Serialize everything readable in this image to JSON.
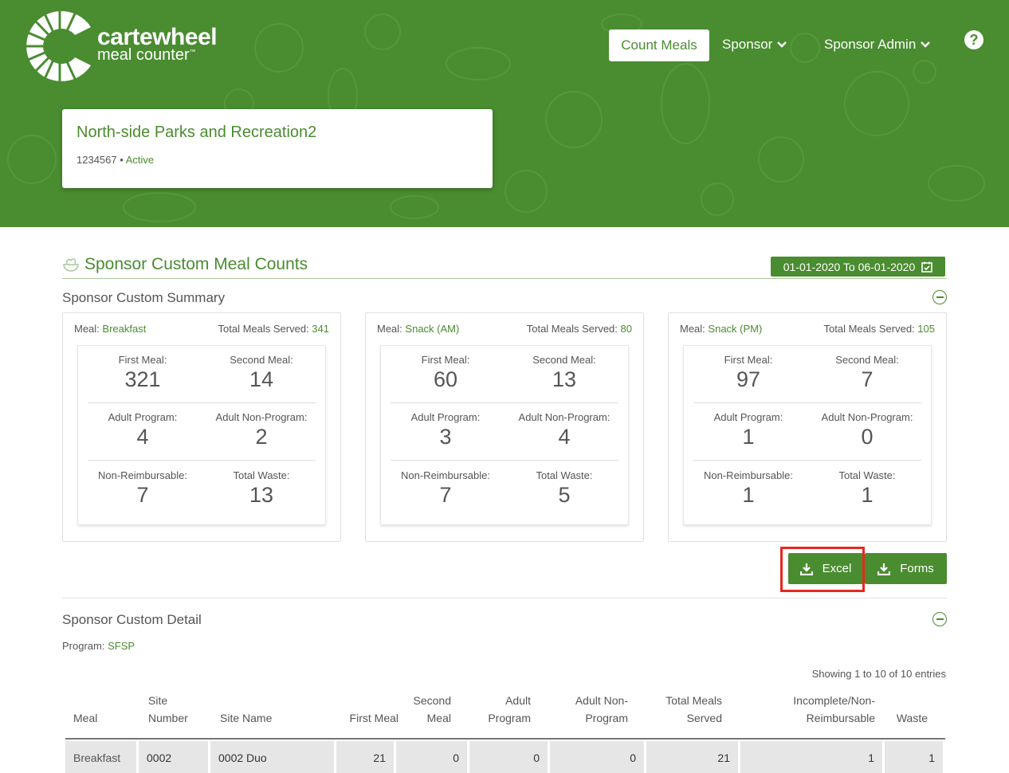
{
  "brand": {
    "name_line1": "cartewheel",
    "name_line2": "meal counter",
    "trademark": "™"
  },
  "nav": {
    "count_meals": "Count Meals",
    "sponsor": "Sponsor",
    "sponsor_admin": "Sponsor Admin",
    "help_icon": "question-circle-icon"
  },
  "org": {
    "name": "North-side Parks and Recreation2",
    "id": "1234567",
    "separator": "•",
    "status": "Active"
  },
  "page": {
    "title": "Sponsor Custom Meal Counts",
    "date_range": "01-01-2020 To 06-01-2020",
    "summary_title": "Sponsor Custom Summary",
    "detail_title": "Sponsor Custom Detail",
    "program_label": "Program:",
    "program_value": "SFSP",
    "showing": "Showing 1 to 10 of 10 entries"
  },
  "labels": {
    "meal": "Meal:",
    "total_meals_served": "Total Meals Served:",
    "first_meal": "First Meal:",
    "second_meal": "Second Meal:",
    "adult_program": "Adult Program:",
    "adult_non_program": "Adult Non-Program:",
    "non_reimbursable": "Non-Reimbursable:",
    "total_waste": "Total Waste:"
  },
  "summary": [
    {
      "meal": "Breakfast",
      "total": "341",
      "first": "321",
      "second": "14",
      "adult_program": "4",
      "adult_non_program": "2",
      "non_reimbursable": "7",
      "waste": "13"
    },
    {
      "meal": "Snack (AM)",
      "total": "80",
      "first": "60",
      "second": "13",
      "adult_program": "3",
      "adult_non_program": "4",
      "non_reimbursable": "7",
      "waste": "5"
    },
    {
      "meal": "Snack (PM)",
      "total": "105",
      "first": "97",
      "second": "7",
      "adult_program": "1",
      "adult_non_program": "0",
      "non_reimbursable": "1",
      "waste": "1"
    }
  ],
  "buttons": {
    "excel": "Excel",
    "forms": "Forms"
  },
  "table": {
    "headers": {
      "meal": "Meal",
      "site_number": "Site Number",
      "site_name": "Site Name",
      "first_meal": "First Meal",
      "second_meal": "Second Meal",
      "adult_program": "Adult Program",
      "adult_non_program": "Adult Non-Program",
      "total_meals_served": "Total Meals Served",
      "incomplete": "Incomplete/Non-Reimbursable",
      "waste": "Waste"
    },
    "rows": [
      {
        "meal": "Breakfast",
        "site_number": "0002",
        "site_name": "0002 Duo",
        "first": "21",
        "second": "0",
        "adult_program": "0",
        "adult_non_program": "0",
        "total": "21",
        "incomplete": "1",
        "waste": "1"
      }
    ]
  },
  "colors": {
    "brand_green": "#4a8c30",
    "highlight_red": "#e8281e"
  }
}
